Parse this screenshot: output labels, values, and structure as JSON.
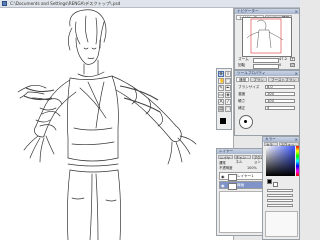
{
  "window": {
    "title": "C:\\Documents and Settings\\RENGA\\デスクトップ\\.psd"
  },
  "navigator": {
    "title": "ナビゲーター",
    "tabs": [
      "ナビゲーター",
      "レイヤー情報"
    ],
    "zoom_label": "ズーム",
    "zoom_value": "47.2",
    "rotate_label": "回転",
    "rotate_value": "0"
  },
  "tool_property": {
    "title": "ツールプロパティ",
    "tabs": [
      "通常",
      "ブラシ",
      "ブーストブラシ"
    ],
    "rows": [
      {
        "label": "ブラシサイズ",
        "value": "8.0"
      },
      {
        "label": "濃度",
        "value": "100"
      },
      {
        "label": "硬さ",
        "value": "100"
      },
      {
        "label": "補正",
        "value": "4"
      }
    ]
  },
  "layer_panel": {
    "title": "レイヤー",
    "tabs": [
      "レイヤー",
      "チャンネル",
      "アクション"
    ],
    "blend_mode": "通常",
    "opacity_label": "不透明度",
    "opacity_value": "100%",
    "layers": [
      {
        "name": "レイヤー1",
        "selected": false
      },
      {
        "name": "線画",
        "selected": true
      }
    ]
  },
  "color_panel": {
    "title": "カラー",
    "tabs": [
      "カラー",
      "スウォッチ"
    ],
    "main_color": "#000000",
    "sub_color": "#ffffff",
    "accent": "#3d58ff"
  },
  "icons": [
    "move-icon",
    "brush-icon",
    "pen-icon",
    "eraser-icon",
    "fill-icon",
    "select-icon",
    "hand-icon",
    "zoom-icon",
    "eye-icon",
    "close-icon"
  ]
}
